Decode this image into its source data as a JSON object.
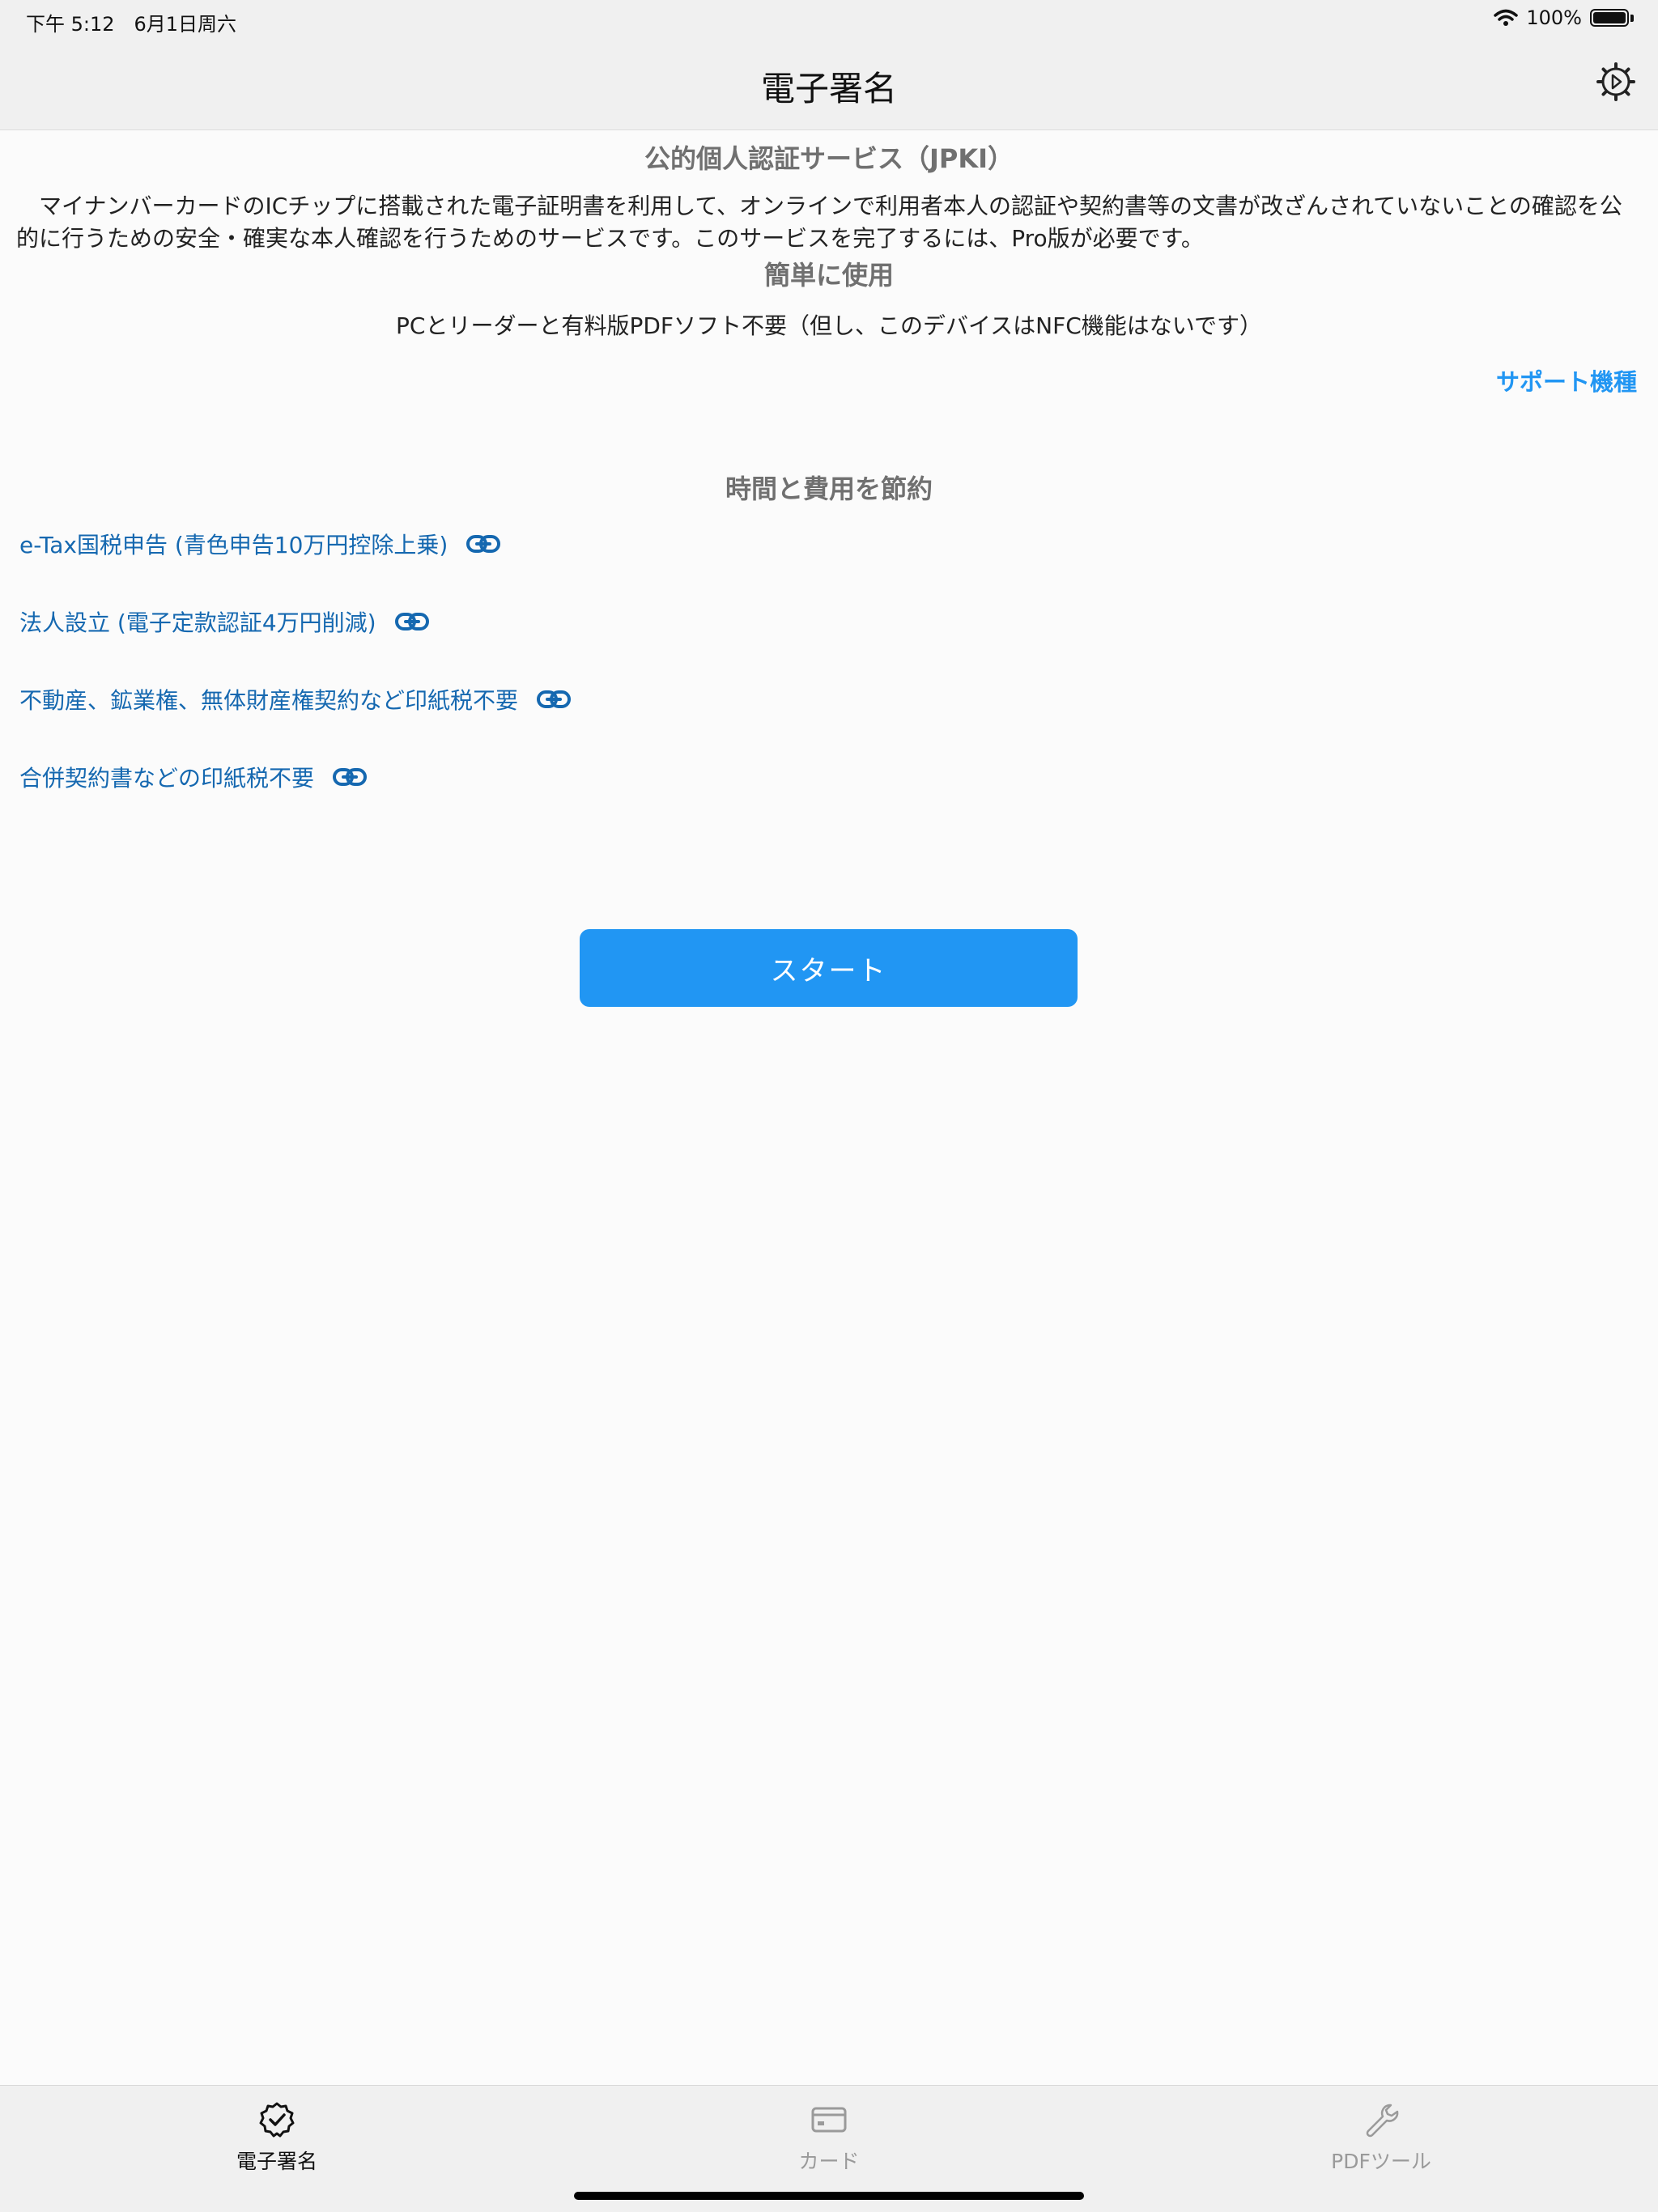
{
  "status": {
    "time_date": "下午 5:12　6月1日周六",
    "battery_pct": "100%"
  },
  "nav": {
    "title": "電子署名",
    "settings_icon": "gear-icon"
  },
  "main": {
    "jpki_title": "公的個人認証サービス（JPKI）",
    "jpki_desc": "マイナンバーカードのICチップに搭載された電子証明書を利用して、オンラインで利用者本人の認証や契約書等の文書が改ざんされていないことの確認を公的に行うための安全・確実な本人確認を行うためのサービスです。このサービスを完了するには、Pro版が必要です。",
    "easy_title": "簡単に使用",
    "easy_desc": "PCとリーダーと有料版PDFソフト不要（但し、このデバイスはNFC機能はないです）",
    "support_link": "サポート機種",
    "save_title": "時間と費用を節約",
    "benefits": [
      {
        "label": "e-Tax国税申告 (青色申告10万円控除上乗)",
        "icon": "link-icon"
      },
      {
        "label": "法人設立 (電子定款認証4万円削減)",
        "icon": "link-icon"
      },
      {
        "label": "不動産、鉱業権、無体財産権契約など印紙税不要",
        "icon": "link-icon"
      },
      {
        "label": "合併契約書などの印紙税不要",
        "icon": "link-icon"
      }
    ],
    "start_button": "スタート"
  },
  "tabs": [
    {
      "label": "電子署名",
      "icon": "seal-check-icon",
      "active": true
    },
    {
      "label": "カード",
      "icon": "card-icon",
      "active": false
    },
    {
      "label": "PDFツール",
      "icon": "wrench-icon",
      "active": false
    }
  ],
  "colors": {
    "accent": "#2196f3",
    "link": "#1568b0",
    "bar_bg": "#f0f0f0"
  }
}
